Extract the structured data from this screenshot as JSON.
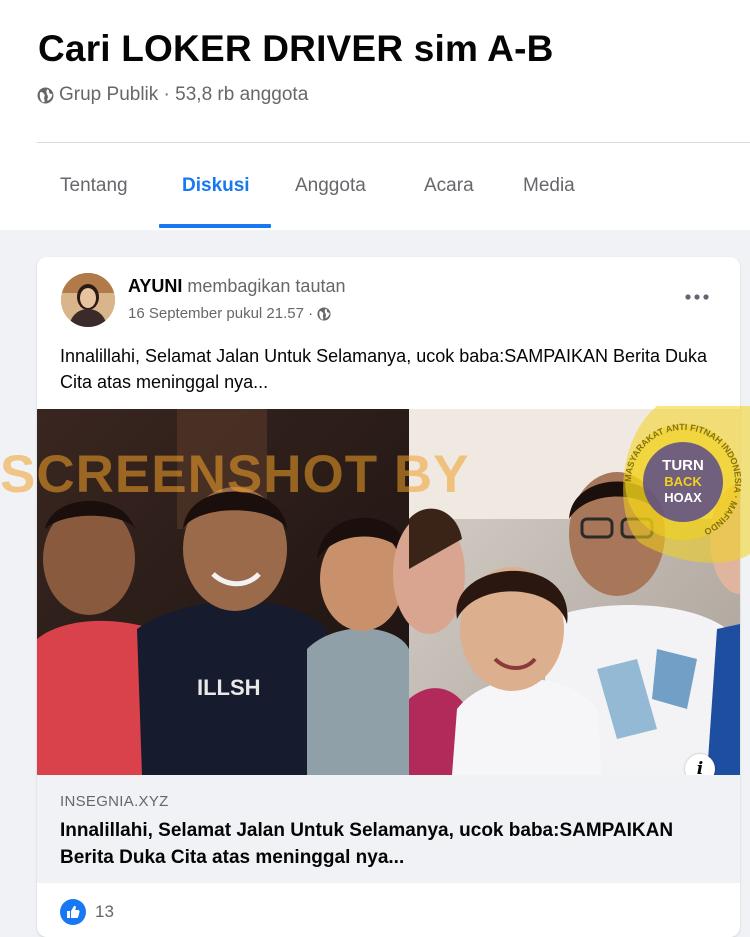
{
  "group": {
    "title": "Cari LOKER DRIVER sim A-B",
    "meta": "Grup Publik · 53,8 rb anggota"
  },
  "tabs": [
    {
      "label": "Tentang",
      "active": false
    },
    {
      "label": "Diskusi",
      "active": true
    },
    {
      "label": "Anggota",
      "active": false
    },
    {
      "label": "Acara",
      "active": false
    },
    {
      "label": "Media",
      "active": false
    }
  ],
  "post": {
    "author": "AYUNI",
    "action": "membagikan tautan",
    "time": "16 September pukul 21.57 ·",
    "text": "Innalillahi, Selamat Jalan Untuk Selamanya, ucok baba:SAMPAIKAN Berita Duka Cita atas meninggal nya...",
    "link": {
      "domain": "INSEGNIA.XYZ",
      "title": "Innalillahi, Selamat Jalan Untuk Selamanya, ucok baba:SAMPAIKAN Berita Duka Cita atas meninggal nya...",
      "info_label": "i"
    },
    "reactions": {
      "count": "13"
    }
  },
  "overlays": {
    "watermark": "SCREENSHOT BY",
    "seal_lines": [
      "TURN",
      "BACK",
      "HOAX"
    ],
    "seal_ring_text": "MASYARAKAT ANTI FITNAH INDONESIA · MAFINDO"
  },
  "colors": {
    "accent": "#1877f2",
    "secondary_text": "#65676b",
    "background": "#f0f2f5",
    "watermark": "#f0a028",
    "seal": "#f2d21b"
  },
  "icons": [
    "globe-icon",
    "more-icon",
    "info-icon",
    "like-icon"
  ]
}
